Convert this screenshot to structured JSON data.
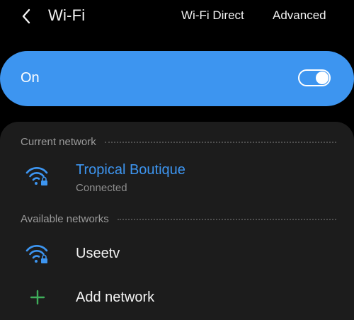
{
  "header": {
    "title": "Wi-Fi",
    "back_icon": "chevron-left-icon",
    "actions": {
      "wifi_direct": "Wi-Fi Direct",
      "advanced": "Advanced"
    }
  },
  "toggle": {
    "label": "On",
    "state": "on",
    "accent_color": "#3d95f0"
  },
  "current_network": {
    "section_title": "Current network",
    "name": "Tropical Boutique",
    "status": "Connected",
    "icon": "wifi-locked-icon",
    "name_color": "#3d95f0"
  },
  "available_networks": {
    "section_title": "Available networks",
    "items": [
      {
        "name": "Useetv",
        "icon": "wifi-locked-icon"
      }
    ]
  },
  "add_network": {
    "label": "Add network",
    "icon": "plus-icon",
    "icon_color": "#3fae5a"
  }
}
